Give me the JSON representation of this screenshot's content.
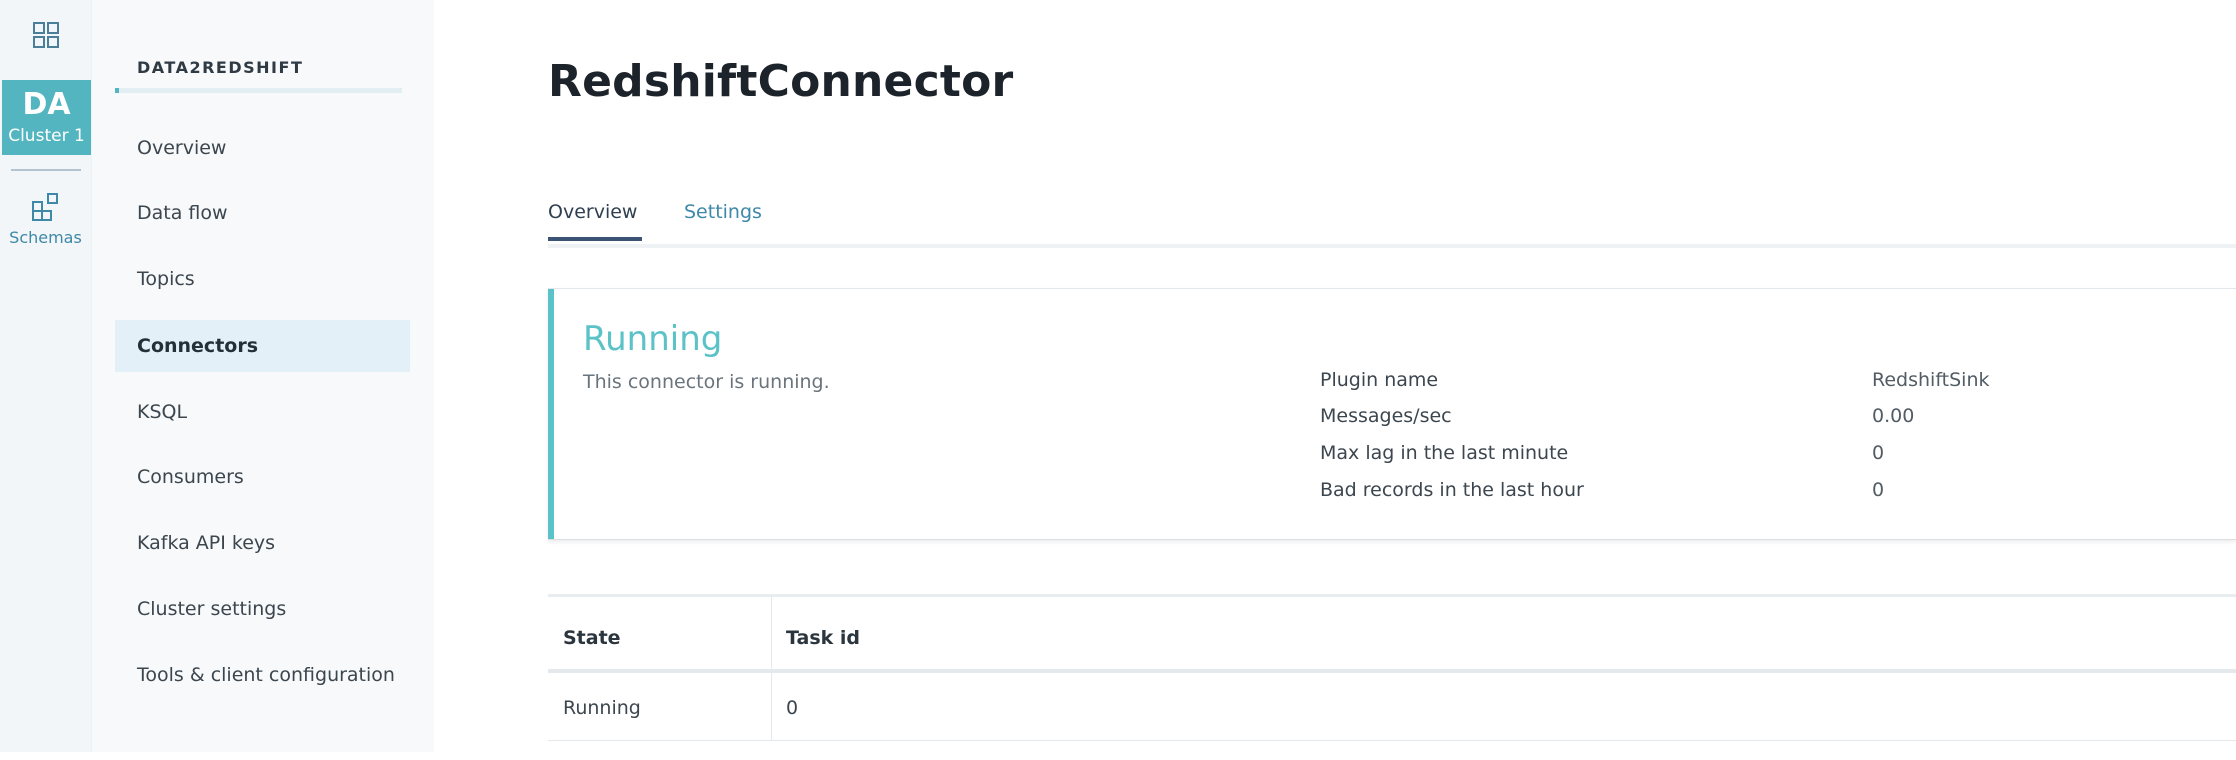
{
  "rail": {
    "cluster_abbr": "DA",
    "cluster_name": "Cluster 1",
    "schemas_label": "Schemas"
  },
  "sidebar": {
    "cluster_title": "DATA2REDSHIFT",
    "items": [
      {
        "label": "Overview"
      },
      {
        "label": "Data flow"
      },
      {
        "label": "Topics"
      },
      {
        "label": "Connectors"
      },
      {
        "label": "KSQL"
      },
      {
        "label": "Consumers"
      },
      {
        "label": "Kafka API keys"
      },
      {
        "label": "Cluster settings"
      },
      {
        "label": "Tools & client configuration"
      }
    ],
    "active_item": "Connectors"
  },
  "main": {
    "title": "RedshiftConnector",
    "tabs": [
      {
        "label": "Overview"
      },
      {
        "label": "Settings"
      }
    ],
    "active_tab": "Overview",
    "status": {
      "title": "Running",
      "description": "This connector is running.",
      "details": [
        {
          "key": "Plugin name",
          "value": "RedshiftSink"
        },
        {
          "key": "Messages/sec",
          "value": "0.00"
        },
        {
          "key": "Max lag in the last minute",
          "value": "0"
        },
        {
          "key": "Bad records in the last hour",
          "value": "0"
        }
      ]
    },
    "tasks": {
      "columns": [
        "State",
        "Task id"
      ],
      "rows": [
        [
          "Running",
          "0"
        ]
      ]
    }
  },
  "colors": {
    "accent_teal": "#5bc2c8",
    "cluster_tile": "#52b5c0",
    "link_blue": "#3e88a8",
    "active_nav_bg": "#e3f0f7"
  }
}
